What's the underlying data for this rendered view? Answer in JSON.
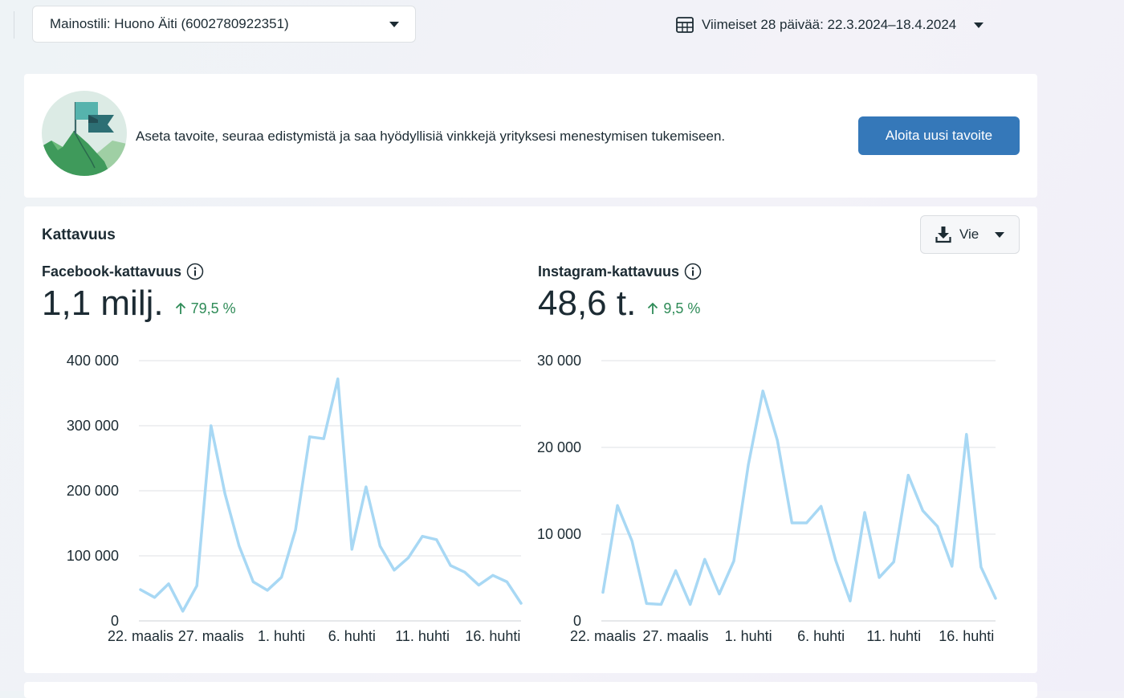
{
  "account_select": {
    "label": "Mainostili: Huono Äiti (6002780922351)"
  },
  "date_range": {
    "label": "Viimeiset 28 päivää: 22.3.2024–18.4.2024"
  },
  "goal_banner": {
    "text": "Aseta tavoite, seuraa edistymistä ja saa hyödyllisiä vinkkejä yrityksesi menestymisen tukemiseen.",
    "button_label": "Aloita uusi tavoite"
  },
  "reach": {
    "title": "Kattavuus",
    "export_label": "Vie",
    "facebook": {
      "title": "Facebook-kattavuus",
      "value": "1,1 milj.",
      "delta": "79,5 %"
    },
    "instagram": {
      "title": "Instagram-kattavuus",
      "value": "48,6 t.",
      "delta": "9,5 %"
    }
  },
  "colors": {
    "accent_button": "#3578b9",
    "line": "#a8d8f4",
    "positive": "#2e8b57"
  },
  "chart_data": [
    {
      "type": "line",
      "title": "Facebook-kattavuus",
      "x": [
        "22.3.",
        "23.3.",
        "24.3.",
        "25.3.",
        "26.3.",
        "27.3.",
        "28.3.",
        "29.3.",
        "30.3.",
        "31.3.",
        "1.4.",
        "2.4.",
        "3.4.",
        "4.4.",
        "5.4.",
        "6.4.",
        "7.4.",
        "8.4.",
        "9.4.",
        "10.4.",
        "11.4.",
        "12.4.",
        "13.4.",
        "14.4.",
        "15.4.",
        "16.4.",
        "17.4.",
        "18.4."
      ],
      "xtick_labels": [
        "22. maalis",
        "27. maalis",
        "1. huhti",
        "6. huhti",
        "11. huhti",
        "16. huhti"
      ],
      "xtick_indices": [
        0,
        5,
        10,
        15,
        20,
        25
      ],
      "y": [
        48000,
        36000,
        57000,
        15000,
        54000,
        300000,
        195000,
        115000,
        60000,
        47000,
        67000,
        140000,
        283000,
        280000,
        372000,
        110000,
        206000,
        115000,
        78000,
        97000,
        130000,
        125000,
        85000,
        75000,
        55000,
        70000,
        60000,
        27000
      ],
      "yticks": [
        0,
        100000,
        200000,
        300000,
        400000
      ],
      "ytick_labels": [
        "0",
        "100 000",
        "200 000",
        "300 000",
        "400 000"
      ],
      "ylim": [
        0,
        400000
      ],
      "grid": true
    },
    {
      "type": "line",
      "title": "Instagram-kattavuus",
      "x": [
        "22.3.",
        "23.3.",
        "24.3.",
        "25.3.",
        "26.3.",
        "27.3.",
        "28.3.",
        "29.3.",
        "30.3.",
        "31.3.",
        "1.4.",
        "2.4.",
        "3.4.",
        "4.4.",
        "5.4.",
        "6.4.",
        "7.4.",
        "8.4.",
        "9.4.",
        "10.4.",
        "11.4.",
        "12.4.",
        "13.4.",
        "14.4.",
        "15.4.",
        "16.4.",
        "17.4.",
        "18.4."
      ],
      "xtick_labels": [
        "22. maalis",
        "27. maalis",
        "1. huhti",
        "6. huhti",
        "11. huhti",
        "16. huhti"
      ],
      "xtick_indices": [
        0,
        5,
        10,
        15,
        20,
        25
      ],
      "y": [
        3300,
        13300,
        9200,
        2000,
        1900,
        5800,
        1900,
        7100,
        3100,
        6900,
        18000,
        26500,
        20800,
        11300,
        11300,
        13200,
        7000,
        2300,
        12500,
        5000,
        6800,
        16800,
        12700,
        10900,
        6300,
        21500,
        6200,
        2600
      ],
      "yticks": [
        0,
        10000,
        20000,
        30000
      ],
      "ytick_labels": [
        "0",
        "10 000",
        "20 000",
        "30 000"
      ],
      "ylim": [
        0,
        30000
      ],
      "grid": true
    }
  ]
}
